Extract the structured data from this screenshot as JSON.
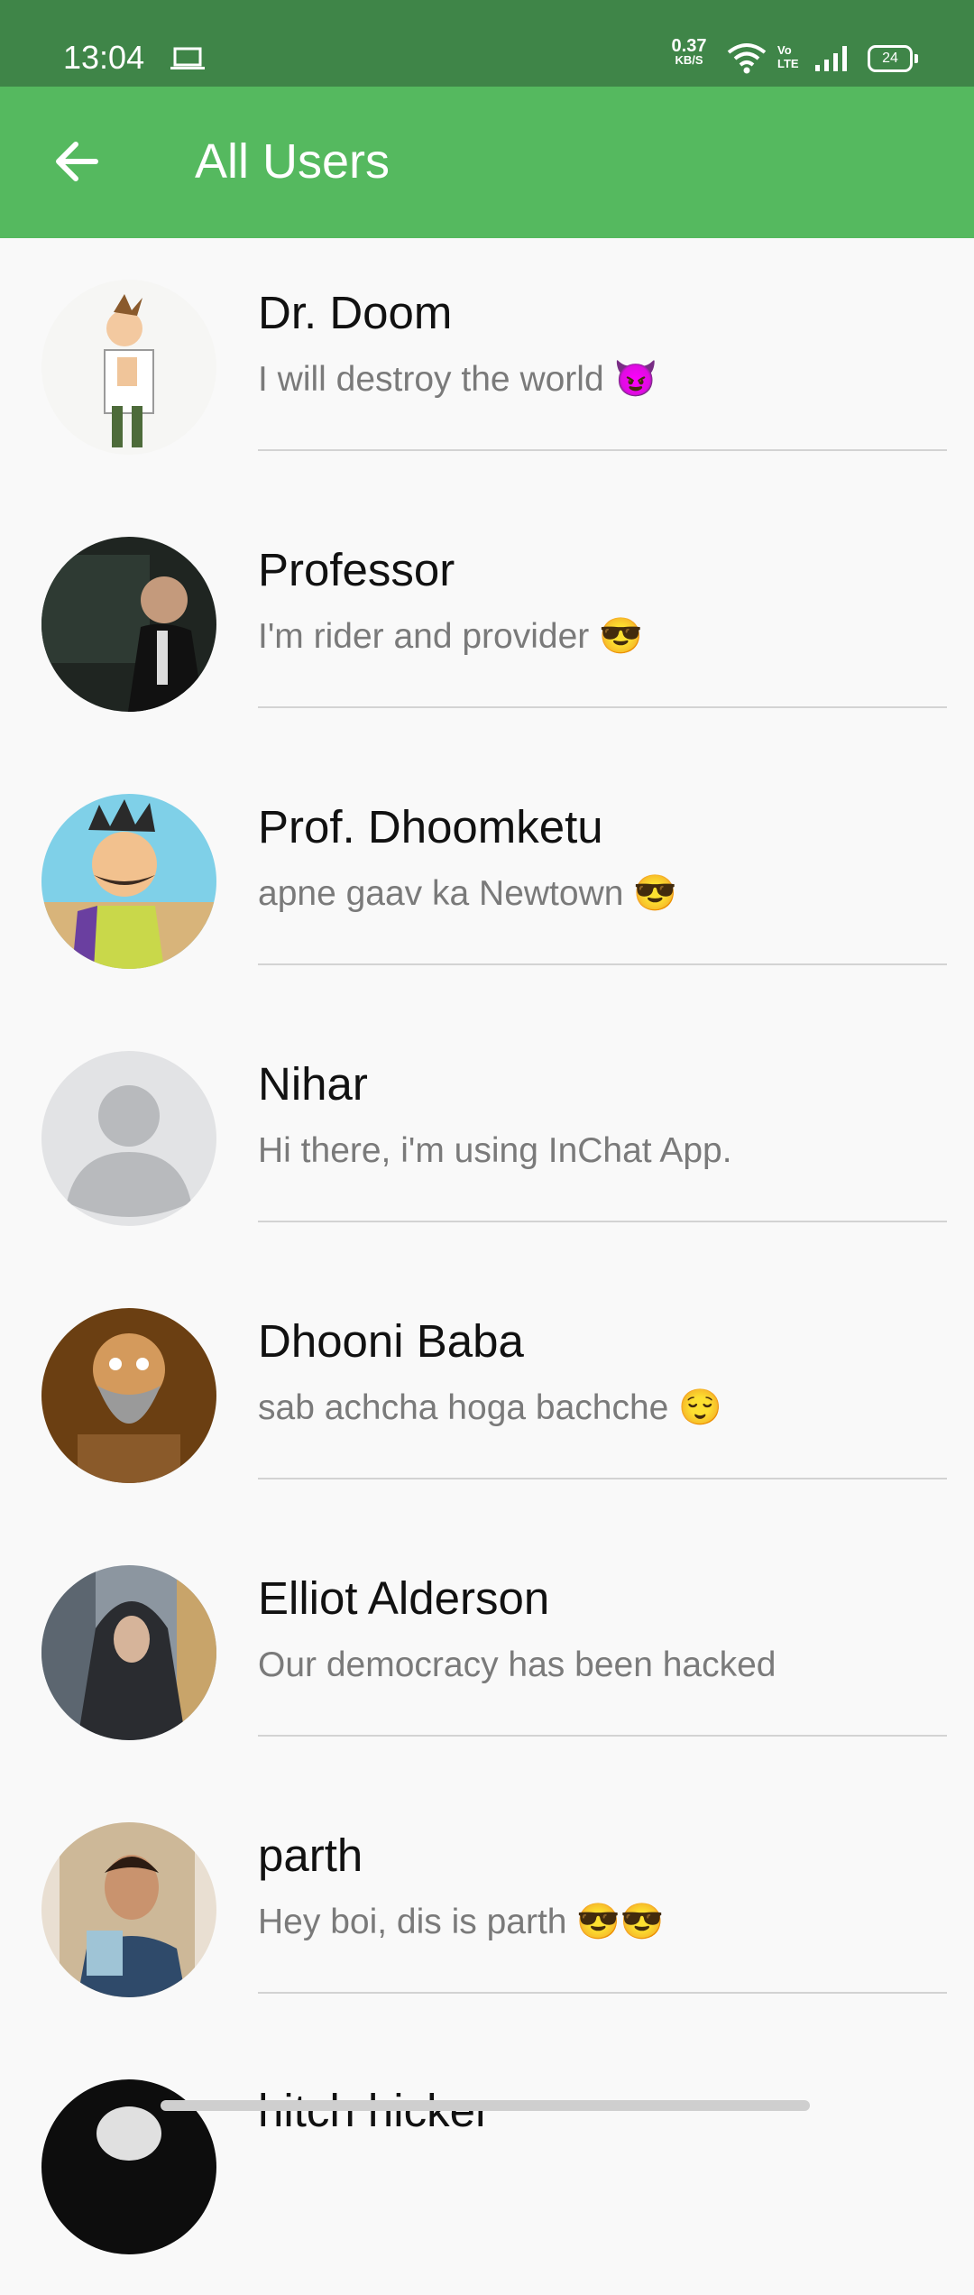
{
  "status_bar": {
    "time": "13:04",
    "net_speed_value": "0.37",
    "net_speed_unit": "KB/S",
    "volte_top": "Vo",
    "volte_bottom": "LTE",
    "battery": "24",
    "icons": [
      "laptop-icon",
      "wifi-icon",
      "signal-icon",
      "battery-icon"
    ]
  },
  "app_bar": {
    "title": "All Users",
    "back_icon": "arrow-left-icon",
    "color": "#55b95f"
  },
  "users": [
    {
      "name": "Dr. Doom",
      "status": "I will destroy the world 😈",
      "avatar": "doofenshmirtz-avatar"
    },
    {
      "name": "Professor",
      "status": "I'm rider and provider 😎",
      "avatar": "professor-avatar"
    },
    {
      "name": "Prof. Dhoomketu",
      "status": "apne gaav ka Newtown 😎",
      "avatar": "dhoomketu-avatar"
    },
    {
      "name": "Nihar",
      "status": "Hi there, i'm using InChat App.",
      "avatar": "default-person-avatar"
    },
    {
      "name": "Dhooni Baba",
      "status": "sab achcha hoga bachche 😌",
      "avatar": "dhooni-baba-avatar"
    },
    {
      "name": "Elliot Alderson",
      "status": "Our democracy has been hacked",
      "avatar": "elliot-avatar"
    },
    {
      "name": "parth",
      "status": "Hey boi, dis is parth 😎😎",
      "avatar": "parth-avatar"
    },
    {
      "name": "hitch hicker",
      "status": "",
      "avatar": "hitch-hicker-avatar"
    }
  ],
  "colors": {
    "status_bar": "#3f8548",
    "app_bar": "#55b95f",
    "background": "#f9f9f9",
    "name_text": "#111111",
    "status_text": "#7a7a7a",
    "divider": "#d3d3d3"
  }
}
